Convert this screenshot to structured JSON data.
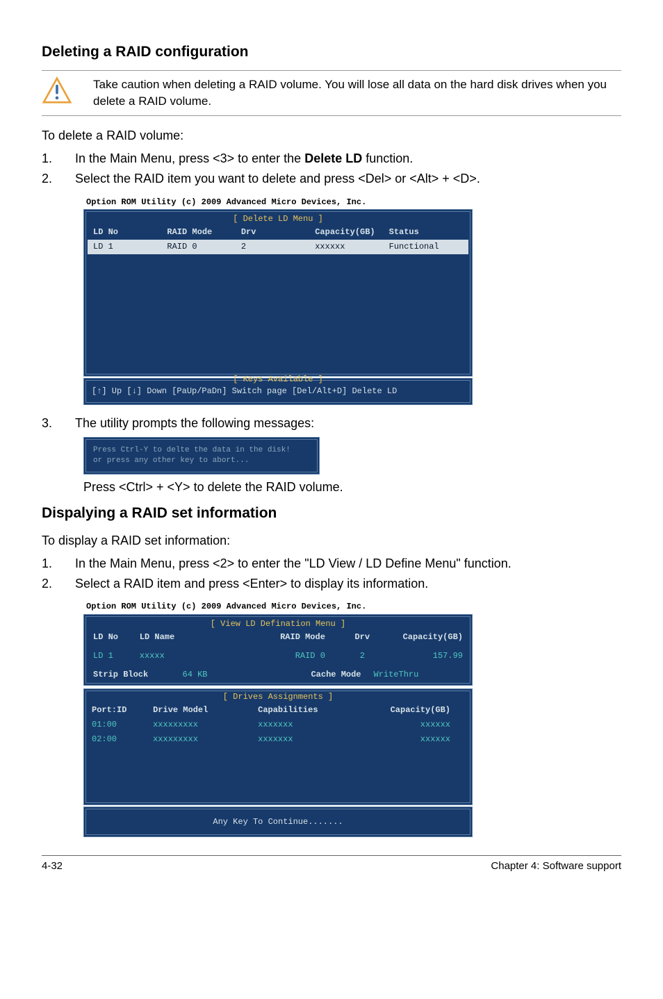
{
  "headings": {
    "deleting": "Deleting a RAID configuration",
    "displaying": "Dispalying a RAID set information"
  },
  "caution": "Take caution when deleting a RAID volume. You will lose all data on the hard disk drives when you delete a RAID volume.",
  "deleteIntro": "To delete a RAID volume:",
  "deleteSteps": {
    "s1num": "1.",
    "s1a": "In the Main Menu, press <3> to enter the ",
    "s1b": "Delete LD",
    "s1c": " function.",
    "s2num": "2.",
    "s2": "Select the RAID item you want to delete and press <Del> or <Alt> + <D>.",
    "s3num": "3.",
    "s3": "The utility prompts the following messages:"
  },
  "bios1": {
    "title": "Option ROM Utility (c) 2009 Advanced Micro Devices, Inc.",
    "menuLabel": "[ Delete LD Menu ]",
    "headers": {
      "c1": "LD No",
      "c2": "RAID Mode",
      "c3": "Drv",
      "c4": "Capacity(GB)",
      "c5": "Status"
    },
    "row": {
      "c1": "LD  1",
      "c2": "RAID 0",
      "c3": "2",
      "c4": "xxxxxx",
      "c5": "Functional"
    },
    "keysLabel": "[ Keys Available ]",
    "keys": "[↑] Up  [↓] Down  [PaUp/PaDn] Switch page  [Del/Alt+D] Delete LD"
  },
  "prompt": {
    "l1": "Press Ctrl-Y to delte the data in the disk!",
    "l2": "or press any other key to abort..."
  },
  "pressCtrlY": "Press <Ctrl> + <Y> to delete the RAID volume.",
  "displayIntro": "To display a RAID set information:",
  "displaySteps": {
    "s1num": "1.",
    "s1": "In the Main Menu, press <2> to enter the \"LD View / LD Define Menu\" function.",
    "s2num": "2.",
    "s2": "Select a RAID item and press <Enter> to display its information."
  },
  "bios2": {
    "title": "Option ROM Utility (c) 2009 Advanced Micro Devices, Inc.",
    "menuLabel": "[ View LD Defination Menu ]",
    "hdr": {
      "c1": "LD No",
      "c2": "LD Name",
      "c3": "RAID Mode",
      "c4": "Drv",
      "c5": "Capacity(GB)"
    },
    "row": {
      "c1": "LD  1",
      "c2": "xxxxx",
      "c3": "RAID 0",
      "c4": "2",
      "c5": "157.99"
    },
    "strip": {
      "l": "Strip Block",
      "v1": "64 KB",
      "r": "Cache Mode",
      "v2": "WriteThru"
    },
    "drivesLabel": "[ Drives Assignments ]",
    "dhdr": {
      "c1": "Port:ID",
      "c2": "Drive Model",
      "c3": "Capabilities",
      "c4": "Capacity(GB)"
    },
    "drows": [
      {
        "c1": "01:00",
        "c2": "xxxxxxxxx",
        "c3": "xxxxxxx",
        "c4": "xxxxxx"
      },
      {
        "c1": "02:00",
        "c2": "xxxxxxxxx",
        "c3": "xxxxxxx",
        "c4": "xxxxxx"
      }
    ],
    "anykey": "Any Key To Continue......."
  },
  "footer": {
    "left": "4-32",
    "right": "Chapter 4: Software support"
  }
}
